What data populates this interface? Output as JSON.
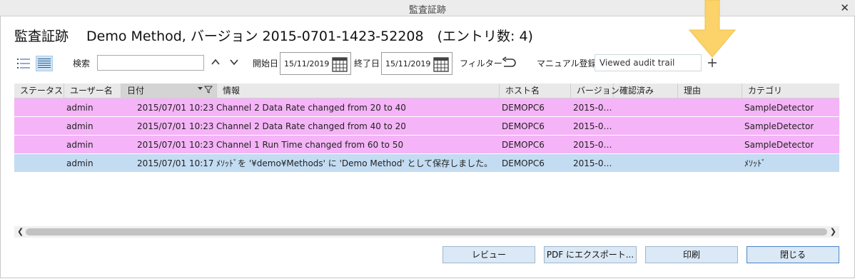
{
  "window": {
    "title": "監査証跡"
  },
  "heading": "監査証跡　 Demo Method, バージョン 2015-0701-1423-52208　(エントリ数: 4)",
  "toolbar": {
    "search_label": "検索",
    "search_value": "",
    "start_label": "開始日",
    "start_date": "15/11/2019",
    "end_label": "終了日",
    "end_date": "15/11/2019",
    "filter_label": "フィルター",
    "manual_label": "マニュアル登録",
    "manual_value": "Viewed audit trail"
  },
  "table": {
    "columns": [
      "ステータス",
      "ユーザー名",
      "日付",
      "情報",
      "ホスト名",
      "バージョン",
      "確認済み",
      "理由",
      "カテゴリ"
    ],
    "rows": [
      {
        "status": "",
        "user": "admin",
        "date": "2015/07/01 10:23",
        "info": "Channel 2 Data Rate changed from 20 to 40",
        "host": "DEMOPC6",
        "version": "2015-0…",
        "confirmed": "",
        "reason": "",
        "category": "SampleDetector"
      },
      {
        "status": "",
        "user": "admin",
        "date": "2015/07/01 10:23",
        "info": "Channel 2 Data Rate changed from 40 to 20",
        "host": "DEMOPC6",
        "version": "2015-0…",
        "confirmed": "",
        "reason": "",
        "category": "SampleDetector"
      },
      {
        "status": "",
        "user": "admin",
        "date": "2015/07/01 10:23",
        "info": "Channel 1 Run Time changed from 60 to 50",
        "host": "DEMOPC6",
        "version": "2015-0…",
        "confirmed": "",
        "reason": "",
        "category": "SampleDetector"
      },
      {
        "status": "",
        "user": "admin",
        "date": "2015/07/01 10:17",
        "info": "ﾒｿｯﾄﾞを '¥demo¥Methods' に 'Demo Method' として保存しました。",
        "host": "DEMOPC6",
        "version": "2015-0…",
        "confirmed": "",
        "reason": "",
        "category": "ﾒｿｯﾄﾞ"
      }
    ]
  },
  "buttons": {
    "review": "レビュー",
    "export_pdf": "PDF にエクスポート...",
    "print": "印刷",
    "close": "閉じる"
  },
  "colors": {
    "row_changed": "#f5b4f7",
    "row_selected": "#c3dcf2",
    "button_bg": "#dbe8f5",
    "annotation_arrow": "#fcd36a"
  }
}
